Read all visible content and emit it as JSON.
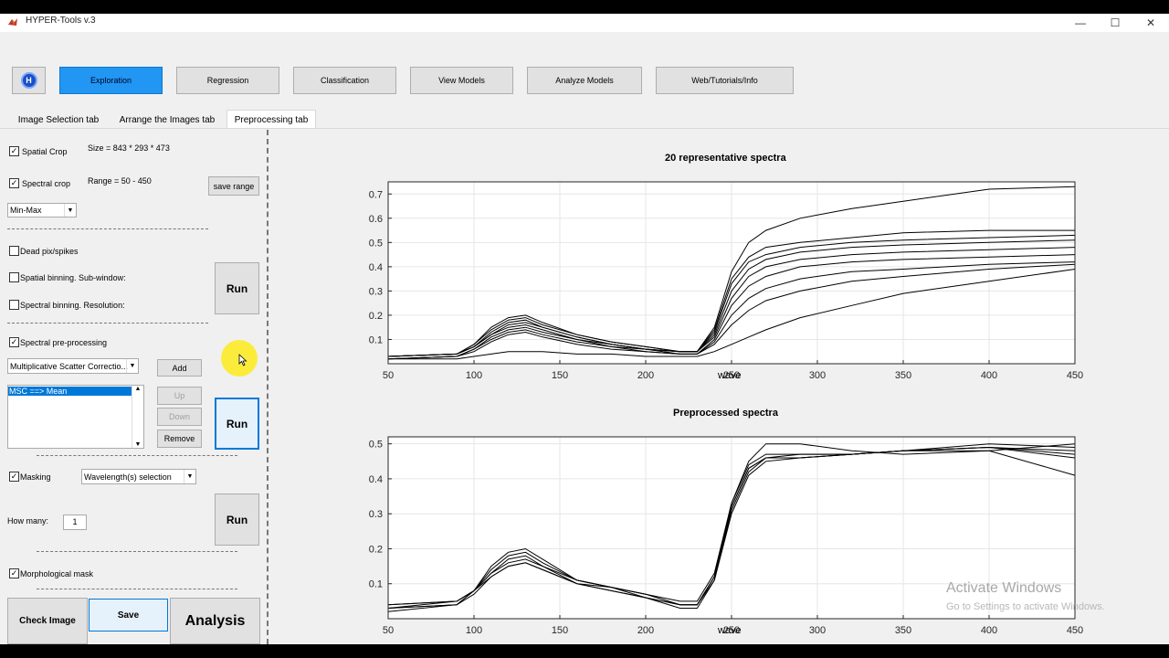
{
  "window": {
    "title": "HYPER-Tools v.3",
    "controls": {
      "minimize": "—",
      "maximize": "☐",
      "close": "✕"
    }
  },
  "toolbar": {
    "logo_text": "H",
    "buttons": [
      "Exploration",
      "Regression",
      "Classification",
      "View Models",
      "Analyze Models",
      "Web/Tutorials/Info"
    ],
    "active": "Exploration"
  },
  "tabs": [
    "Image Selection tab",
    "Arrange the Images tab",
    "Preprocessing tab"
  ],
  "selected_tab": "Preprocessing tab",
  "left_panel": {
    "spatial_crop": {
      "label": "Spatial Crop",
      "checked": true,
      "info": "Size = 843 * 293 * 473"
    },
    "spectral_crop": {
      "label": "Spectral crop",
      "checked": true,
      "info": "Range = 50 - 450"
    },
    "save_range_label": "save range",
    "norm_select": "Min-Max",
    "dead_pix": {
      "label": "Dead pix/spikes",
      "checked": false
    },
    "spatial_binning": {
      "label": "Spatial binning. Sub-window:",
      "checked": false
    },
    "spectral_binning": {
      "label": "Spectral binning. Resolution:",
      "checked": false
    },
    "run_label": "Run",
    "spectral_pre": {
      "label": "Spectral pre-processing",
      "checked": true
    },
    "method_select": "Multiplicative Scatter Correctio...",
    "add_label": "Add",
    "list_items": [
      "MSC ==> Mean"
    ],
    "up_label": "Up",
    "down_label": "Down",
    "remove_label": "Remove",
    "masking": {
      "label": "Masking",
      "checked": true
    },
    "mask_select": "Wavelength(s) selection",
    "how_many_label": "How many:",
    "how_many_value": "1",
    "morph_mask": {
      "label": "Morphological mask",
      "checked": true
    },
    "check_image_label": "Check Image",
    "save_label": "Save",
    "analysis_label": "Analysis"
  },
  "watermark": {
    "line1": "Activate Windows",
    "line2": "Go to Settings to activate Windows."
  },
  "chart_data": [
    {
      "type": "line",
      "title": "20 representative spectra",
      "xlabel": "wave",
      "ylabel": "",
      "xlim": [
        50,
        450
      ],
      "ylim": [
        0,
        0.75
      ],
      "xticks": [
        50,
        100,
        150,
        200,
        250,
        300,
        350,
        400,
        450
      ],
      "yticks": [
        0.1,
        0.2,
        0.3,
        0.4,
        0.5,
        0.6,
        0.7
      ],
      "grid": true,
      "x": [
        50,
        90,
        100,
        110,
        120,
        130,
        140,
        160,
        180,
        200,
        220,
        230,
        240,
        250,
        260,
        270,
        290,
        320,
        350,
        400,
        450
      ],
      "series": [
        {
          "values": [
            0.03,
            0.04,
            0.08,
            0.15,
            0.19,
            0.2,
            0.17,
            0.12,
            0.09,
            0.07,
            0.05,
            0.05,
            0.15,
            0.38,
            0.5,
            0.55,
            0.6,
            0.64,
            0.67,
            0.72,
            0.73
          ]
        },
        {
          "values": [
            0.03,
            0.04,
            0.08,
            0.14,
            0.18,
            0.19,
            0.16,
            0.12,
            0.09,
            0.07,
            0.05,
            0.05,
            0.14,
            0.35,
            0.44,
            0.48,
            0.5,
            0.52,
            0.54,
            0.55,
            0.55
          ]
        },
        {
          "values": [
            0.03,
            0.04,
            0.07,
            0.13,
            0.17,
            0.18,
            0.15,
            0.11,
            0.08,
            0.06,
            0.05,
            0.05,
            0.13,
            0.33,
            0.42,
            0.45,
            0.48,
            0.5,
            0.51,
            0.52,
            0.53
          ]
        },
        {
          "values": [
            0.03,
            0.04,
            0.07,
            0.12,
            0.16,
            0.17,
            0.15,
            0.11,
            0.08,
            0.06,
            0.05,
            0.05,
            0.12,
            0.3,
            0.39,
            0.43,
            0.46,
            0.48,
            0.49,
            0.5,
            0.51
          ]
        },
        {
          "values": [
            0.03,
            0.04,
            0.07,
            0.12,
            0.15,
            0.16,
            0.14,
            0.1,
            0.08,
            0.06,
            0.05,
            0.05,
            0.11,
            0.27,
            0.36,
            0.4,
            0.43,
            0.45,
            0.46,
            0.47,
            0.48
          ]
        },
        {
          "values": [
            0.02,
            0.03,
            0.06,
            0.11,
            0.14,
            0.15,
            0.13,
            0.1,
            0.07,
            0.06,
            0.04,
            0.04,
            0.1,
            0.24,
            0.32,
            0.36,
            0.4,
            0.42,
            0.43,
            0.44,
            0.45
          ]
        },
        {
          "values": [
            0.02,
            0.03,
            0.06,
            0.1,
            0.13,
            0.14,
            0.12,
            0.09,
            0.07,
            0.05,
            0.04,
            0.04,
            0.09,
            0.2,
            0.27,
            0.31,
            0.35,
            0.38,
            0.39,
            0.41,
            0.42
          ]
        },
        {
          "values": [
            0.02,
            0.03,
            0.05,
            0.09,
            0.12,
            0.13,
            0.11,
            0.08,
            0.06,
            0.05,
            0.04,
            0.04,
            0.08,
            0.16,
            0.22,
            0.26,
            0.3,
            0.34,
            0.36,
            0.39,
            0.41
          ]
        },
        {
          "values": [
            0.02,
            0.02,
            0.03,
            0.04,
            0.05,
            0.05,
            0.05,
            0.04,
            0.04,
            0.03,
            0.03,
            0.03,
            0.05,
            0.08,
            0.11,
            0.14,
            0.19,
            0.24,
            0.29,
            0.34,
            0.39
          ]
        }
      ]
    },
    {
      "type": "line",
      "title": "Preprocessed spectra",
      "xlabel": "wave",
      "ylabel": "",
      "xlim": [
        50,
        450
      ],
      "ylim": [
        0,
        0.52
      ],
      "xticks": [
        50,
        100,
        150,
        200,
        250,
        300,
        350,
        400,
        450
      ],
      "yticks": [
        0.1,
        0.2,
        0.3,
        0.4,
        0.5
      ],
      "grid": true,
      "x": [
        50,
        90,
        100,
        110,
        120,
        130,
        140,
        160,
        180,
        200,
        220,
        230,
        240,
        250,
        260,
        270,
        290,
        320,
        350,
        400,
        450
      ],
      "series": [
        {
          "values": [
            0.03,
            0.05,
            0.08,
            0.15,
            0.19,
            0.2,
            0.17,
            0.11,
            0.09,
            0.07,
            0.04,
            0.04,
            0.12,
            0.33,
            0.45,
            0.5,
            0.5,
            0.48,
            0.47,
            0.48,
            0.5
          ]
        },
        {
          "values": [
            0.04,
            0.05,
            0.08,
            0.14,
            0.18,
            0.19,
            0.16,
            0.11,
            0.09,
            0.07,
            0.05,
            0.05,
            0.13,
            0.33,
            0.44,
            0.47,
            0.47,
            0.47,
            0.48,
            0.49,
            0.48
          ]
        },
        {
          "values": [
            0.03,
            0.04,
            0.08,
            0.13,
            0.17,
            0.18,
            0.15,
            0.11,
            0.09,
            0.07,
            0.04,
            0.04,
            0.12,
            0.32,
            0.43,
            0.46,
            0.47,
            0.47,
            0.48,
            0.49,
            0.47
          ]
        },
        {
          "values": [
            0.02,
            0.04,
            0.08,
            0.13,
            0.16,
            0.17,
            0.15,
            0.1,
            0.09,
            0.06,
            0.04,
            0.04,
            0.11,
            0.31,
            0.42,
            0.46,
            0.46,
            0.47,
            0.48,
            0.48,
            0.41
          ]
        },
        {
          "values": [
            0.04,
            0.05,
            0.08,
            0.12,
            0.15,
            0.16,
            0.14,
            0.1,
            0.08,
            0.06,
            0.03,
            0.03,
            0.11,
            0.3,
            0.41,
            0.45,
            0.46,
            0.47,
            0.48,
            0.49,
            0.46
          ]
        },
        {
          "values": [
            0.03,
            0.04,
            0.07,
            0.12,
            0.15,
            0.16,
            0.14,
            0.1,
            0.08,
            0.06,
            0.04,
            0.04,
            0.12,
            0.32,
            0.43,
            0.46,
            0.46,
            0.47,
            0.48,
            0.5,
            0.49
          ]
        }
      ]
    }
  ]
}
